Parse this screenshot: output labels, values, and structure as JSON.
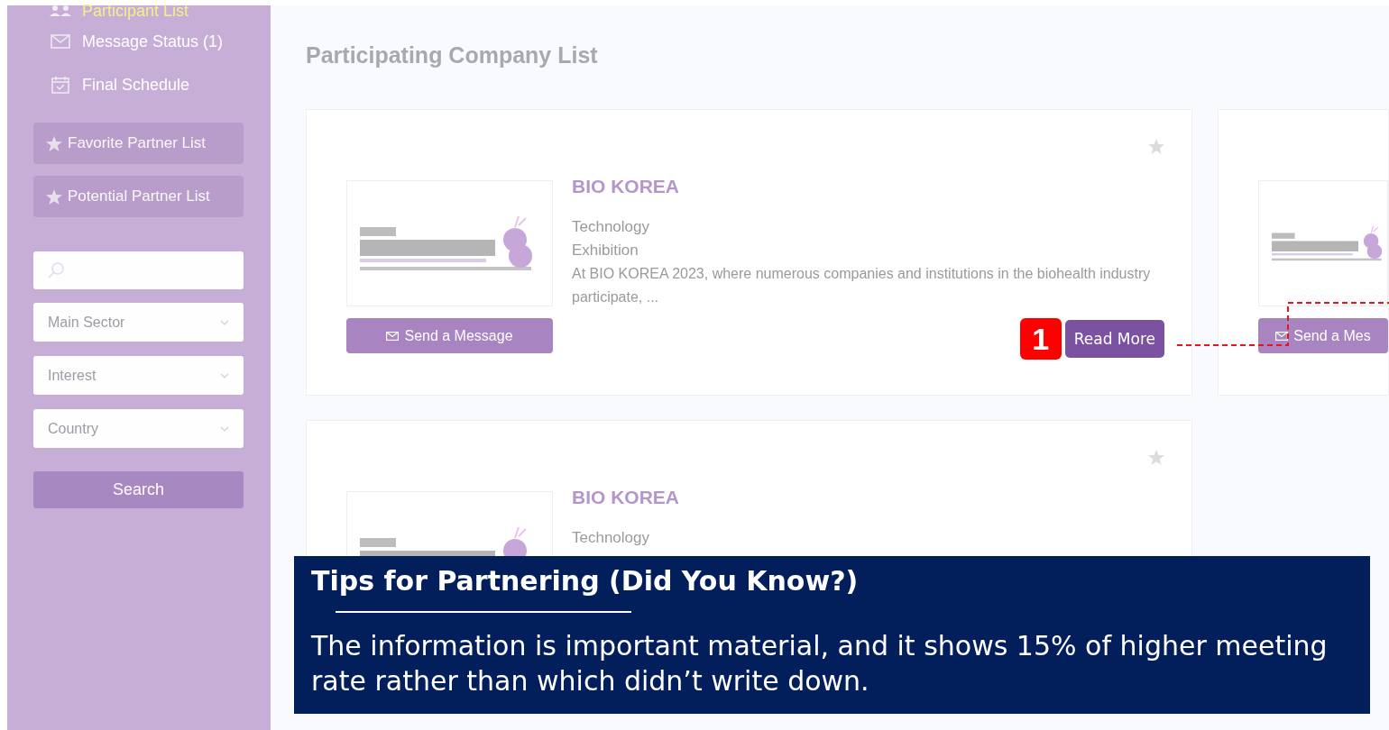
{
  "sidebar": {
    "nav": [
      {
        "label": "Participant List",
        "kind": "people",
        "selected": true
      },
      {
        "label": "Message Status (1)",
        "kind": "envelope",
        "selected": false
      },
      {
        "label": "Final Schedule",
        "kind": "calendar",
        "selected": false
      }
    ],
    "partner_lists": [
      {
        "label": "Favorite Partner List"
      },
      {
        "label": "Potential Partner List"
      }
    ],
    "filters": [
      {
        "placeholder": "Main Sector"
      },
      {
        "placeholder": "Interest"
      },
      {
        "placeholder": "Country"
      }
    ],
    "search_button": "Search"
  },
  "main": {
    "title": "Participating Company List",
    "cards": [
      {
        "favorite": false,
        "name": "BIO KOREA",
        "tags": [
          "Technology",
          "Exhibition"
        ],
        "description": "At BIO KOREA 2023, where numerous companies and institutions in the biohealth industry participate, ...",
        "send_button": "Send a Message",
        "callout": "1",
        "read_more": "Read More"
      },
      {
        "send_button": "Send a Mes"
      },
      {
        "favorite": false,
        "name": "BIO KOREA",
        "tags": [
          "Technology"
        ]
      }
    ]
  },
  "tip": {
    "title": "Tips for Partnering (Did You Know?)",
    "body": "The information is important material, and it shows 15% of higher meeting rate rather than which didn’t write down."
  }
}
